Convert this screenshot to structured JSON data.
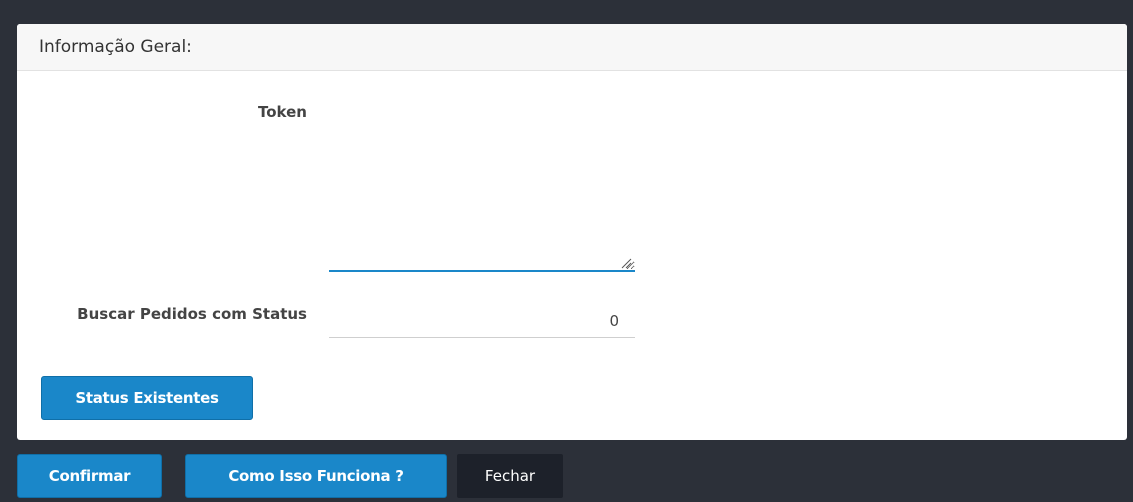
{
  "panel": {
    "heading": "Informação Geral:"
  },
  "form": {
    "token_label": "Token",
    "token_value": "",
    "status_label": "Buscar Pedidos com Status",
    "status_value": "0",
    "status_button": "Status Existentes"
  },
  "footer": {
    "confirm_label": "Confirmar",
    "help_label": "Como Isso Funciona ?",
    "close_label": "Fechar"
  },
  "colors": {
    "primary": "#1a87c9",
    "background": "#2c3039",
    "close_button": "#1d212a",
    "panel": "#ffffff",
    "heading_bg": "#f7f7f7"
  },
  "icons": {
    "resize_grip": "resize-grip-icon"
  }
}
